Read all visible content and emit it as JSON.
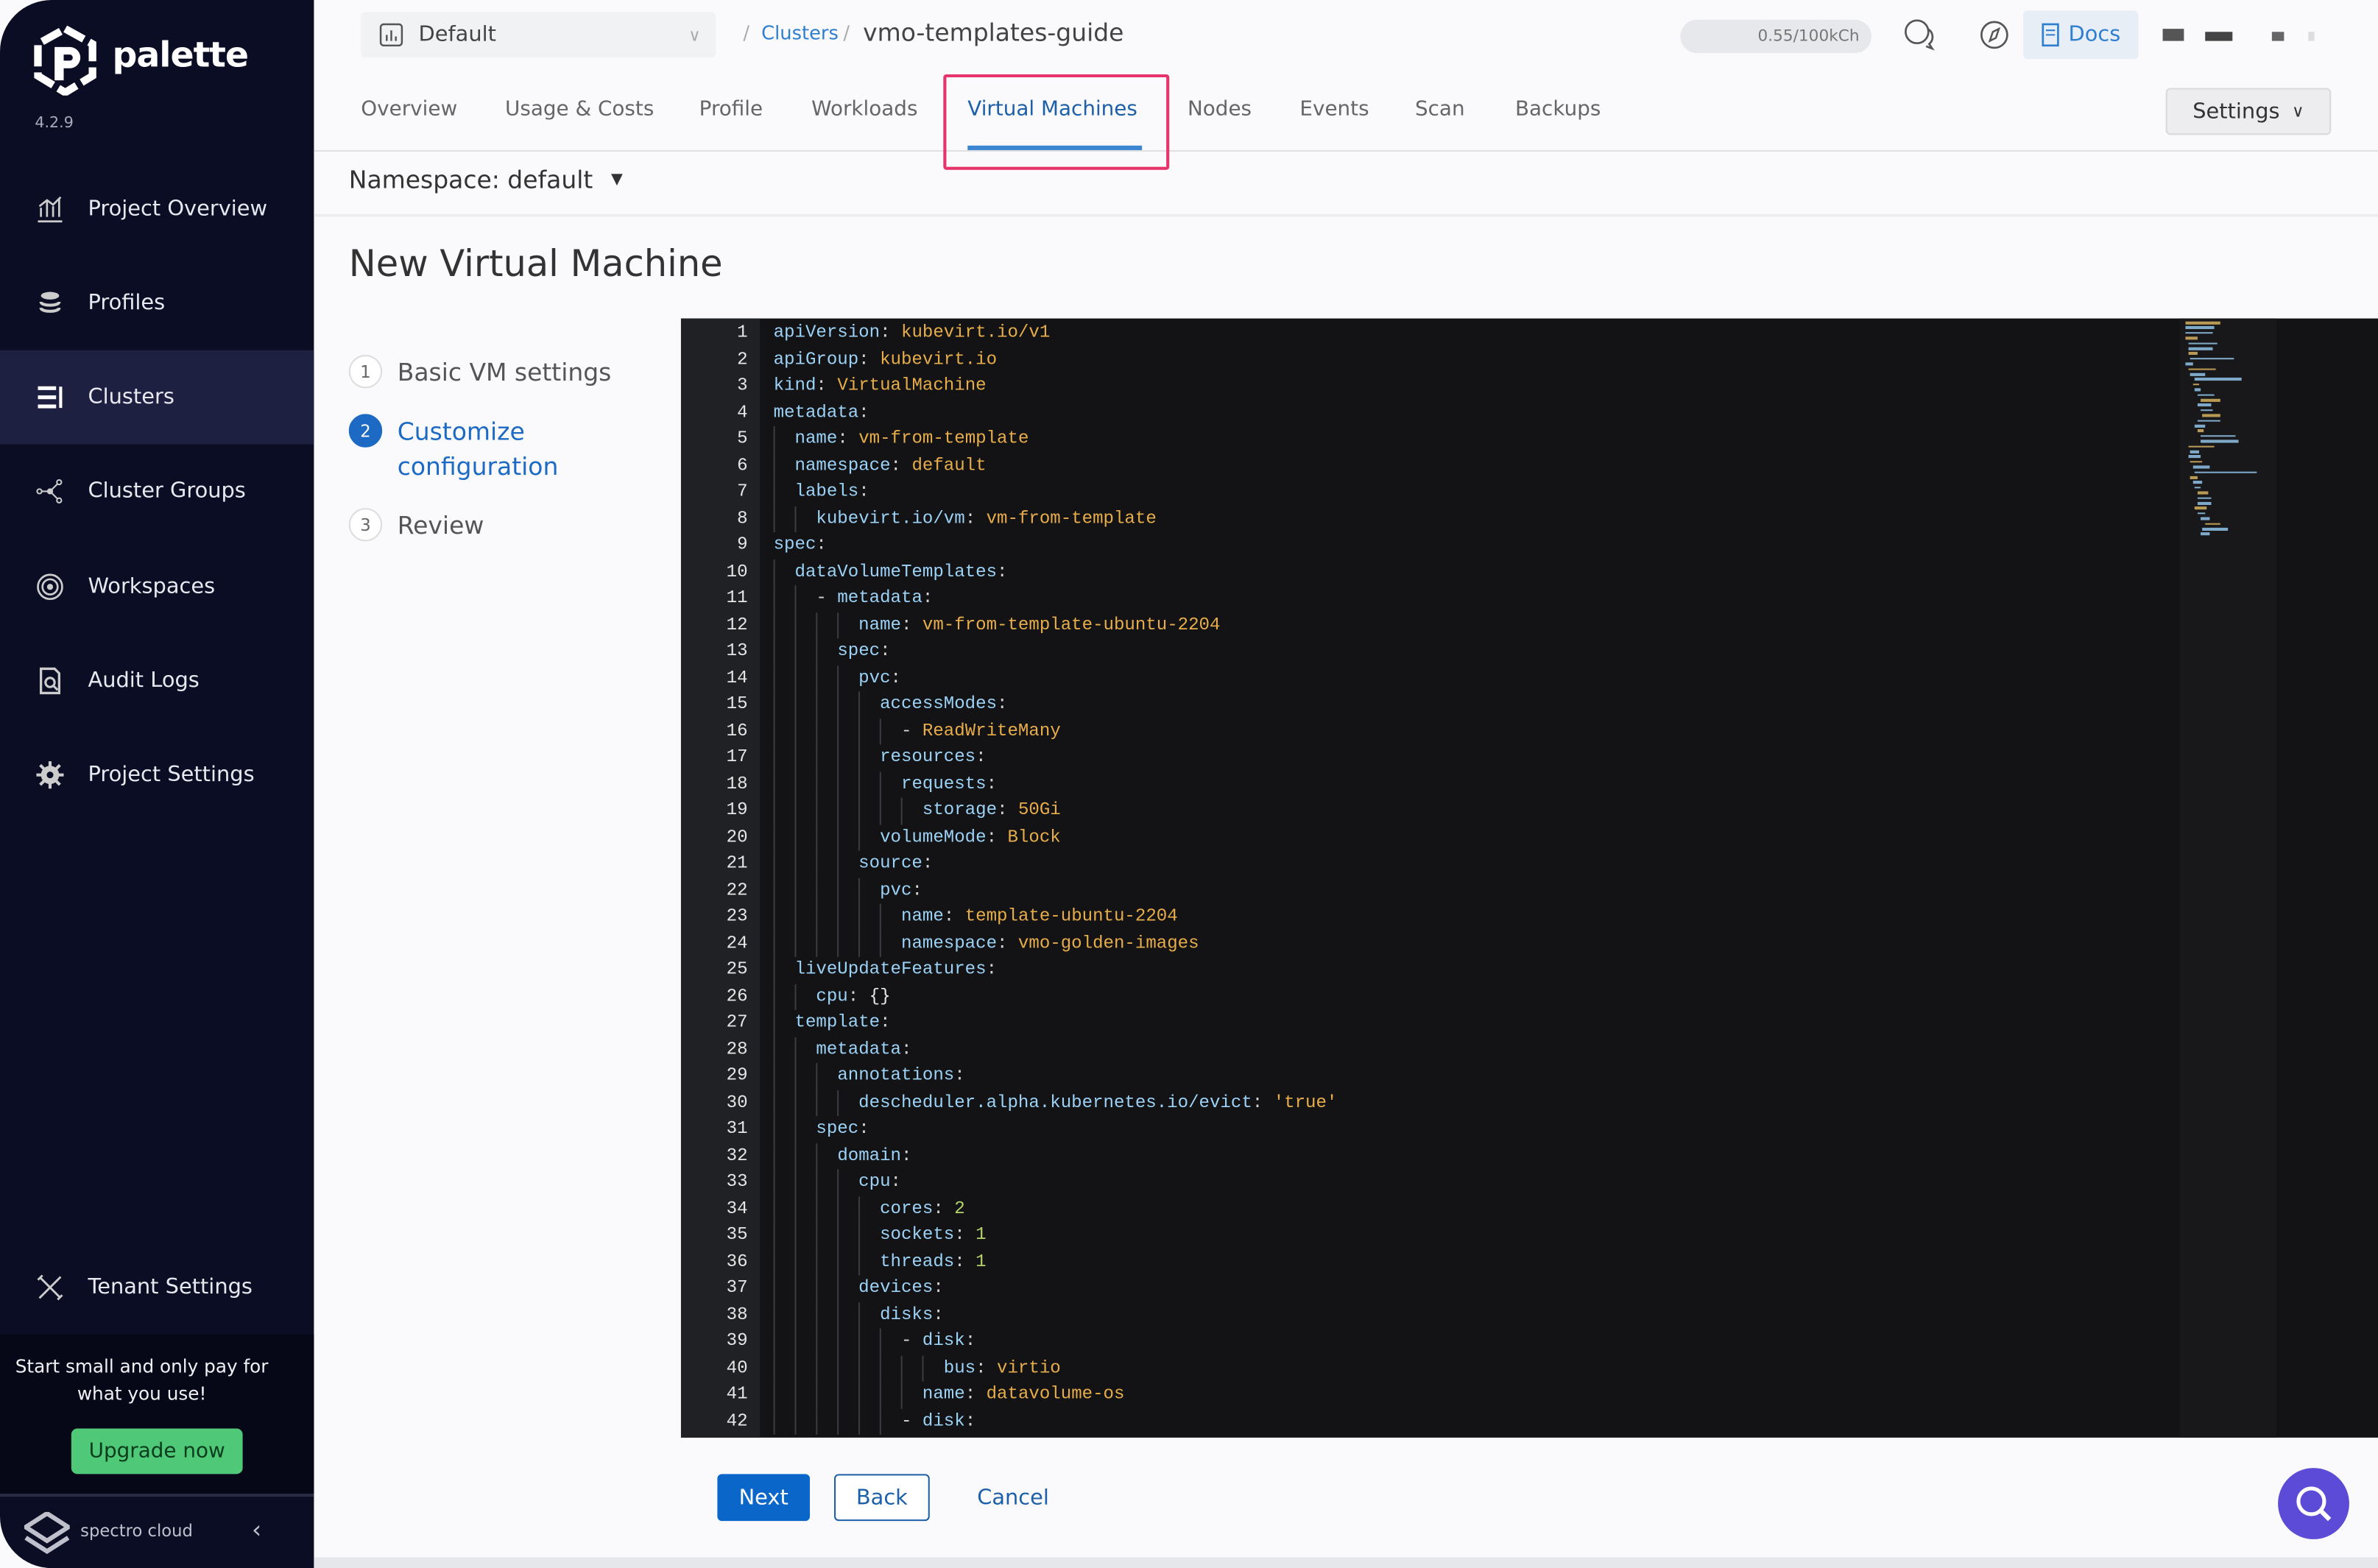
{
  "app": {
    "name": "palette",
    "version": "4.2.9"
  },
  "sidebar": {
    "items": [
      {
        "label": "Project Overview",
        "icon": "chart-icon"
      },
      {
        "label": "Profiles",
        "icon": "stack-icon"
      },
      {
        "label": "Clusters",
        "icon": "clusters-icon",
        "active": true
      },
      {
        "label": "Cluster Groups",
        "icon": "cluster-groups-icon"
      },
      {
        "label": "Workspaces",
        "icon": "workspaces-icon"
      },
      {
        "label": "Audit Logs",
        "icon": "audit-logs-icon"
      },
      {
        "label": "Project Settings",
        "icon": "gear-icon"
      }
    ],
    "tenant_settings": "Tenant Settings",
    "promo": "Start small and only pay for what you use!",
    "upgrade": "Upgrade now",
    "brand": "spectro cloud"
  },
  "header": {
    "project": "Default",
    "breadcrumb": {
      "parent": "Clusters",
      "current": "vmo-templates-guide"
    },
    "credits": "0.55/100kCh",
    "docs": "Docs"
  },
  "tabs": [
    {
      "label": "Overview"
    },
    {
      "label": "Usage & Costs"
    },
    {
      "label": "Profile"
    },
    {
      "label": "Workloads"
    },
    {
      "label": "Virtual Machines",
      "active": true
    },
    {
      "label": "Nodes"
    },
    {
      "label": "Events"
    },
    {
      "label": "Scan"
    },
    {
      "label": "Backups"
    }
  ],
  "settings_label": "Settings",
  "namespace": "Namespace: default",
  "page_title": "New Virtual Machine",
  "steps": [
    {
      "num": "1",
      "label": "Basic VM settings"
    },
    {
      "num": "2",
      "label": "Customize configuration",
      "active": true
    },
    {
      "num": "3",
      "label": "Review"
    }
  ],
  "code": [
    "apiVersion: kubevirt.io/v1",
    "apiGroup: kubevirt.io",
    "kind: VirtualMachine",
    "metadata:",
    "  name: vm-from-template",
    "  namespace: default",
    "  labels:",
    "    kubevirt.io/vm: vm-from-template",
    "spec:",
    "  dataVolumeTemplates:",
    "    - metadata:",
    "        name: vm-from-template-ubuntu-2204",
    "      spec:",
    "        pvc:",
    "          accessModes:",
    "            - ReadWriteMany",
    "          resources:",
    "            requests:",
    "              storage: 50Gi",
    "          volumeMode: Block",
    "        source:",
    "          pvc:",
    "            name: template-ubuntu-2204",
    "            namespace: vmo-golden-images",
    "  liveUpdateFeatures:",
    "    cpu: {}",
    "  template:",
    "    metadata:",
    "      annotations:",
    "        descheduler.alpha.kubernetes.io/evict: 'true'",
    "    spec:",
    "      domain:",
    "        cpu:",
    "          cores: 2",
    "          sockets: 1",
    "          threads: 1",
    "        devices:",
    "          disks:",
    "            - disk:",
    "                bus: virtio",
    "              name: datavolume-os",
    "            - disk:"
  ],
  "buttons": {
    "next": "Next",
    "back": "Back",
    "cancel": "Cancel"
  },
  "colors": {
    "sidebar": "#0b0d24",
    "accent": "#0a66c8",
    "highlight": "#e6336b",
    "upgrade": "#4fc878",
    "fab": "#5b4bd6"
  }
}
